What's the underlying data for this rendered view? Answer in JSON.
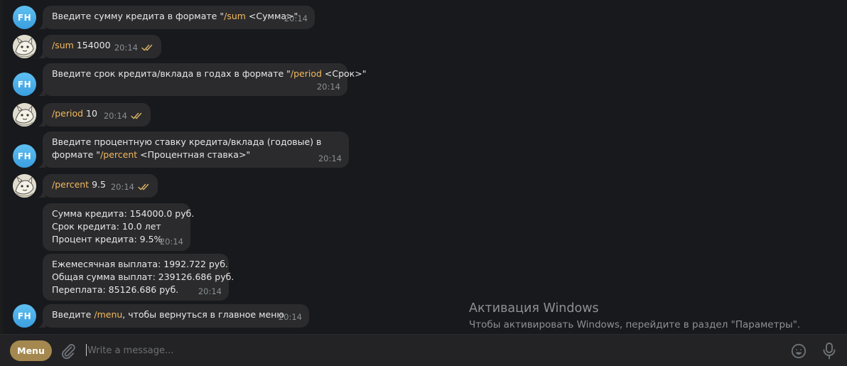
{
  "messages": [
    {
      "sender": "FH",
      "lines": [
        [
          "Введите сумму кредита в формате \"",
          "/sum",
          " <Сумма>\""
        ]
      ],
      "time": "20:14"
    },
    {
      "sender": "user",
      "lines": [
        [
          "",
          "/sum",
          " 154000"
        ]
      ],
      "time": "20:14",
      "read": true
    },
    {
      "sender": "FH",
      "lines": [
        [
          "Введите срок кредита/вклада в годах в формате \"",
          "/period",
          " <Срок>\""
        ]
      ],
      "time": "20:14"
    },
    {
      "sender": "user",
      "lines": [
        [
          "",
          "/period",
          " 10"
        ]
      ],
      "time": "20:14",
      "read": true
    },
    {
      "sender": "FH",
      "lines": [
        [
          "Введите процентную ставку кредита/вклада (годовые) в",
          "",
          ""
        ],
        [
          "формате \"",
          "/percent",
          " <Процентная ставка>\""
        ]
      ],
      "time": "20:14"
    },
    {
      "sender": "user",
      "lines": [
        [
          "",
          "/percent",
          " 9.5"
        ]
      ],
      "time": "20:14",
      "read": true
    },
    {
      "sender": "FH",
      "lines": [
        [
          "Сумма кредита: 154000.0 руб.",
          "",
          ""
        ],
        [
          "Срок кредита: 10.0 лет",
          "",
          ""
        ],
        [
          "Процент кредита: 9.5%",
          "",
          ""
        ]
      ],
      "time": "20:14"
    },
    {
      "sender": "FH",
      "lines": [
        [
          "Ежемесячная выплата: 1992.722 руб.",
          "",
          ""
        ],
        [
          "Общая сумма выплат: 239126.686 руб.",
          "",
          ""
        ],
        [
          "Переплата: 85126.686 руб.",
          "",
          ""
        ]
      ],
      "time": "20:14"
    },
    {
      "sender": "FH",
      "lines": [
        [
          "Введите ",
          "/menu",
          ", чтобы вернуться в главное меню"
        ]
      ],
      "time": "20:14"
    }
  ],
  "bot_avatar_initials": "FH",
  "watermark": {
    "title": "Активация Windows",
    "subtitle": "Чтобы активировать Windows, перейдите в раздел \"Параметры\"."
  },
  "composer": {
    "menu_label": "Menu",
    "placeholder": "Write a message...",
    "value": ""
  },
  "colors": {
    "chat_bg": "#18191d",
    "bubble_bg": "#2b2b2d",
    "command": "#f3b95e",
    "menu_button": "#a5884f",
    "check": "#d9b565",
    "timestamp": "#8a8f93"
  },
  "icons": {
    "attach": "paperclip-icon",
    "emoji": "smile-icon",
    "voice": "microphone-icon",
    "read": "double-check-icon"
  }
}
